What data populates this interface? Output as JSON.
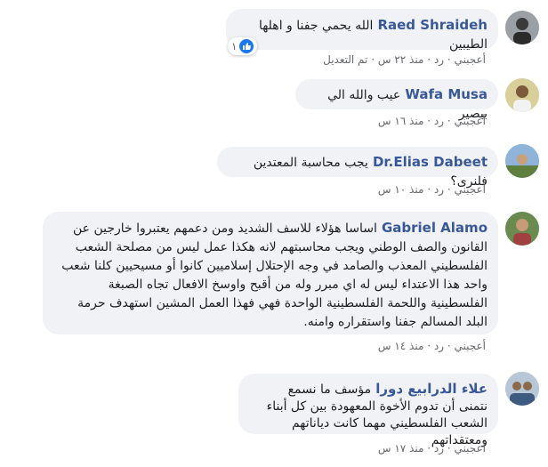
{
  "comments": [
    {
      "author": "Raed Shraideh",
      "text": "الله يحمي جفنا و اهلها الطيبين",
      "like_label": "أعجبني",
      "reply_label": "رد",
      "time": "منذ ٢٢ س",
      "edited": "تم التعديل",
      "reaction_count": "١"
    },
    {
      "author": "Wafa Musa",
      "text": "عيب والله الي بيصير",
      "like_label": "أعجبني",
      "reply_label": "رد",
      "time": "منذ ١٦ س"
    },
    {
      "author": "Dr.Elias Dabeet",
      "text": "يجب محاسبة المعتدين فلنرى؟",
      "like_label": "أعجبني",
      "reply_label": "رد",
      "time": "منذ ١٠ س"
    },
    {
      "author": "Gabriel Alamo",
      "text": "اساسا هؤلاء للاسف الشديد ومن دعمهم يعتبروا خارجين عن القانون والصف الوطني ويجب محاسبتهم لانه هكذا عمل ليس من مصلحة الشعب الفلسطيني المعذب والصامد في وجه الإحتلال إسلاميين كانوا أو مسيحيين كلنا شعب واحد هذا الاعتداء ليس له اي مبرر وله من أقبح واوسخ الافعال تجاه الصبغة الفلسطينية واللحمة الفلسطينية الواحدة فهي فهذا العمل المشين استهدف حرمة البلد المسالم جفنا واستقراره وامنه.",
      "like_label": "أعجبني",
      "reply_label": "رد",
      "time": "منذ ١٤ س"
    },
    {
      "author": "علاء الدرابيع دورا",
      "text_line1": "مؤسف ما نسمع",
      "text_rest": "نتمنى أن تدوم الأخوة المعهودة بين كل أبناء الشعب الفلسطيني مهما كانت دياناتهم ومعتقداتهم",
      "like_label": "أعجبني",
      "reply_label": "رد",
      "time": "منذ ١٧ س"
    }
  ],
  "separator": "·"
}
